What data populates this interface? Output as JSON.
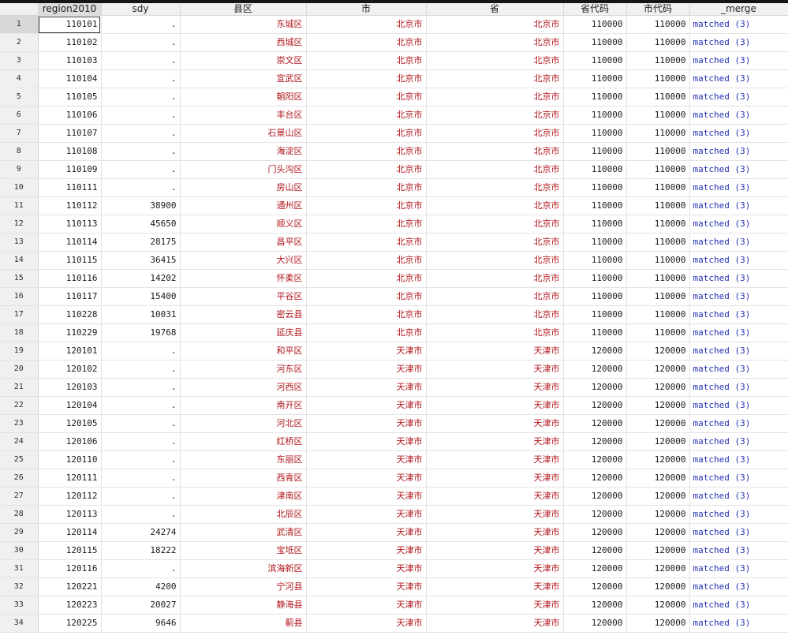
{
  "columns": [
    "region2010",
    "sdy",
    "县区",
    "市",
    "省",
    "省代码",
    "市代码",
    "_merge"
  ],
  "rows": [
    [
      "1",
      "110101",
      ".",
      "东城区",
      "北京市",
      "北京市",
      "110000",
      "110000",
      "matched (3)"
    ],
    [
      "2",
      "110102",
      ".",
      "西城区",
      "北京市",
      "北京市",
      "110000",
      "110000",
      "matched (3)"
    ],
    [
      "3",
      "110103",
      ".",
      "崇文区",
      "北京市",
      "北京市",
      "110000",
      "110000",
      "matched (3)"
    ],
    [
      "4",
      "110104",
      ".",
      "宣武区",
      "北京市",
      "北京市",
      "110000",
      "110000",
      "matched (3)"
    ],
    [
      "5",
      "110105",
      ".",
      "朝阳区",
      "北京市",
      "北京市",
      "110000",
      "110000",
      "matched (3)"
    ],
    [
      "6",
      "110106",
      ".",
      "丰台区",
      "北京市",
      "北京市",
      "110000",
      "110000",
      "matched (3)"
    ],
    [
      "7",
      "110107",
      ".",
      "石景山区",
      "北京市",
      "北京市",
      "110000",
      "110000",
      "matched (3)"
    ],
    [
      "8",
      "110108",
      ".",
      "海淀区",
      "北京市",
      "北京市",
      "110000",
      "110000",
      "matched (3)"
    ],
    [
      "9",
      "110109",
      ".",
      "门头沟区",
      "北京市",
      "北京市",
      "110000",
      "110000",
      "matched (3)"
    ],
    [
      "10",
      "110111",
      ".",
      "房山区",
      "北京市",
      "北京市",
      "110000",
      "110000",
      "matched (3)"
    ],
    [
      "11",
      "110112",
      "38900",
      "通州区",
      "北京市",
      "北京市",
      "110000",
      "110000",
      "matched (3)"
    ],
    [
      "12",
      "110113",
      "45650",
      "顺义区",
      "北京市",
      "北京市",
      "110000",
      "110000",
      "matched (3)"
    ],
    [
      "13",
      "110114",
      "28175",
      "昌平区",
      "北京市",
      "北京市",
      "110000",
      "110000",
      "matched (3)"
    ],
    [
      "14",
      "110115",
      "36415",
      "大兴区",
      "北京市",
      "北京市",
      "110000",
      "110000",
      "matched (3)"
    ],
    [
      "15",
      "110116",
      "14202",
      "怀柔区",
      "北京市",
      "北京市",
      "110000",
      "110000",
      "matched (3)"
    ],
    [
      "16",
      "110117",
      "15400",
      "平谷区",
      "北京市",
      "北京市",
      "110000",
      "110000",
      "matched (3)"
    ],
    [
      "17",
      "110228",
      "10031",
      "密云县",
      "北京市",
      "北京市",
      "110000",
      "110000",
      "matched (3)"
    ],
    [
      "18",
      "110229",
      "19768",
      "延庆县",
      "北京市",
      "北京市",
      "110000",
      "110000",
      "matched (3)"
    ],
    [
      "19",
      "120101",
      ".",
      "和平区",
      "天津市",
      "天津市",
      "120000",
      "120000",
      "matched (3)"
    ],
    [
      "20",
      "120102",
      ".",
      "河东区",
      "天津市",
      "天津市",
      "120000",
      "120000",
      "matched (3)"
    ],
    [
      "21",
      "120103",
      ".",
      "河西区",
      "天津市",
      "天津市",
      "120000",
      "120000",
      "matched (3)"
    ],
    [
      "22",
      "120104",
      ".",
      "南开区",
      "天津市",
      "天津市",
      "120000",
      "120000",
      "matched (3)"
    ],
    [
      "23",
      "120105",
      ".",
      "河北区",
      "天津市",
      "天津市",
      "120000",
      "120000",
      "matched (3)"
    ],
    [
      "24",
      "120106",
      ".",
      "红桥区",
      "天津市",
      "天津市",
      "120000",
      "120000",
      "matched (3)"
    ],
    [
      "25",
      "120110",
      ".",
      "东丽区",
      "天津市",
      "天津市",
      "120000",
      "120000",
      "matched (3)"
    ],
    [
      "26",
      "120111",
      ".",
      "西青区",
      "天津市",
      "天津市",
      "120000",
      "120000",
      "matched (3)"
    ],
    [
      "27",
      "120112",
      ".",
      "津南区",
      "天津市",
      "天津市",
      "120000",
      "120000",
      "matched (3)"
    ],
    [
      "28",
      "120113",
      ".",
      "北辰区",
      "天津市",
      "天津市",
      "120000",
      "120000",
      "matched (3)"
    ],
    [
      "29",
      "120114",
      "24274",
      "武清区",
      "天津市",
      "天津市",
      "120000",
      "120000",
      "matched (3)"
    ],
    [
      "30",
      "120115",
      "18222",
      "宝坻区",
      "天津市",
      "天津市",
      "120000",
      "120000",
      "matched (3)"
    ],
    [
      "31",
      "120116",
      ".",
      "滨海新区",
      "天津市",
      "天津市",
      "120000",
      "120000",
      "matched (3)"
    ],
    [
      "32",
      "120221",
      "4200",
      "宁河县",
      "天津市",
      "天津市",
      "120000",
      "120000",
      "matched (3)"
    ],
    [
      "33",
      "120223",
      "20027",
      "静海县",
      "天津市",
      "天津市",
      "120000",
      "120000",
      "matched (3)"
    ],
    [
      "34",
      "120225",
      "9646",
      "蓟县",
      "天津市",
      "天津市",
      "120000",
      "120000",
      "matched (3)"
    ]
  ],
  "colors": {
    "chinese_text": "#b0171c",
    "merge_text": "#2331b3"
  }
}
